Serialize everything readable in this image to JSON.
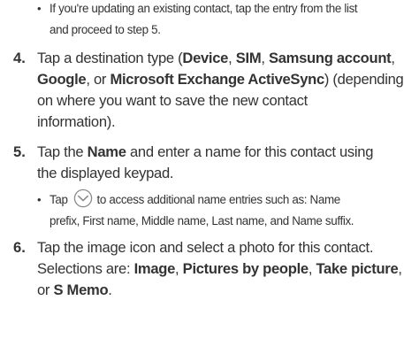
{
  "bullet1": {
    "symbol": "•",
    "line1": "If you're updating an existing contact, tap the entry from the list",
    "line2": "and proceed to step 5."
  },
  "step4": {
    "number": "4.",
    "l1_a": "Tap a destination type (",
    "l1_device": "Device",
    "l1_sep1": ", ",
    "l1_sim": "SIM",
    "l1_sep2": ", ",
    "l1_samsung": "Samsung account",
    "l1_end": ",",
    "l2_google": "Google",
    "l2_sep": ", or ",
    "l2_exchange": "Microsoft Exchange ActiveSync",
    "l2_end": ") (depending",
    "l3": "on where you want to save the new contact",
    "l4": "information)."
  },
  "step5": {
    "number": "5.",
    "l1_a": "Tap the ",
    "l1_name": "Name",
    "l1_b": " and enter a name for this contact using",
    "l2": "the displayed keypad.",
    "bullet_symbol": "•",
    "bullet_tap": "Tap",
    "bullet_icon": "chevron-down-circle-icon",
    "bullet_line1_rest": "to access additional name entries such as: Name",
    "bullet_line2": "prefix, First name, Middle name, Last name, and Name suffix."
  },
  "step6": {
    "number": "6.",
    "l1": "Tap the image icon and select a photo for this contact.",
    "l2_a": "Selections are: ",
    "l2_image": "Image",
    "l2_sep1": ", ",
    "l2_pictures": "Pictures by people",
    "l2_sep2": ", ",
    "l2_take": "Take picture",
    "l2_end": ",",
    "l3_or": "or ",
    "l3_smemo": "S Memo",
    "l3_end": "."
  },
  "colors": {
    "text": "#333333",
    "icon_stroke": "#8a8a8a",
    "background": "#ffffff"
  }
}
